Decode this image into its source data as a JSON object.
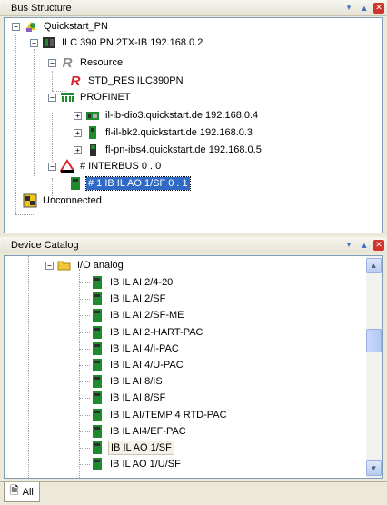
{
  "bus_structure": {
    "title": "Bus Structure",
    "nodes": {
      "project": "Quickstart_PN",
      "controller": "ILC 390 PN 2TX-IB 192.168.0.2",
      "resource": "Resource",
      "std_res": "STD_RES ILC390PN",
      "profinet": "PROFINET",
      "dev1": "il-ib-dio3.quickstart.de 192.168.0.4",
      "dev2": "fl-il-bk2.quickstart.de 192.168.0.3",
      "dev3": "fl-pn-ibs4.quickstart.de 192.168.0.5",
      "interbus": "# INTERBUS 0 . 0",
      "ib_module": "# 1 IB IL AO 1/SF 0 . 1",
      "unconnected": "Unconnected"
    }
  },
  "device_catalog": {
    "title": "Device Catalog",
    "folder": "I/O analog",
    "items": [
      "IB IL AI 2/4-20",
      "IB IL AI 2/SF",
      "IB IL AI 2/SF-ME",
      "IB IL AI 2-HART-PAC",
      "IB IL AI 4/I-PAC",
      "IB IL AI 4/U-PAC",
      "IB IL AI 8/IS",
      "IB IL AI 8/SF",
      "IB IL AI/TEMP 4 RTD-PAC",
      "IB IL AI4/EF-PAC",
      "IB IL AO 1/SF",
      "IB IL AO 1/U/SF"
    ],
    "highlighted_index": 10
  },
  "tabs": {
    "all": "All"
  },
  "colors": {
    "selection": "#316ac5",
    "red_r": "#d8232a",
    "module_green": "#1f8a2e"
  }
}
